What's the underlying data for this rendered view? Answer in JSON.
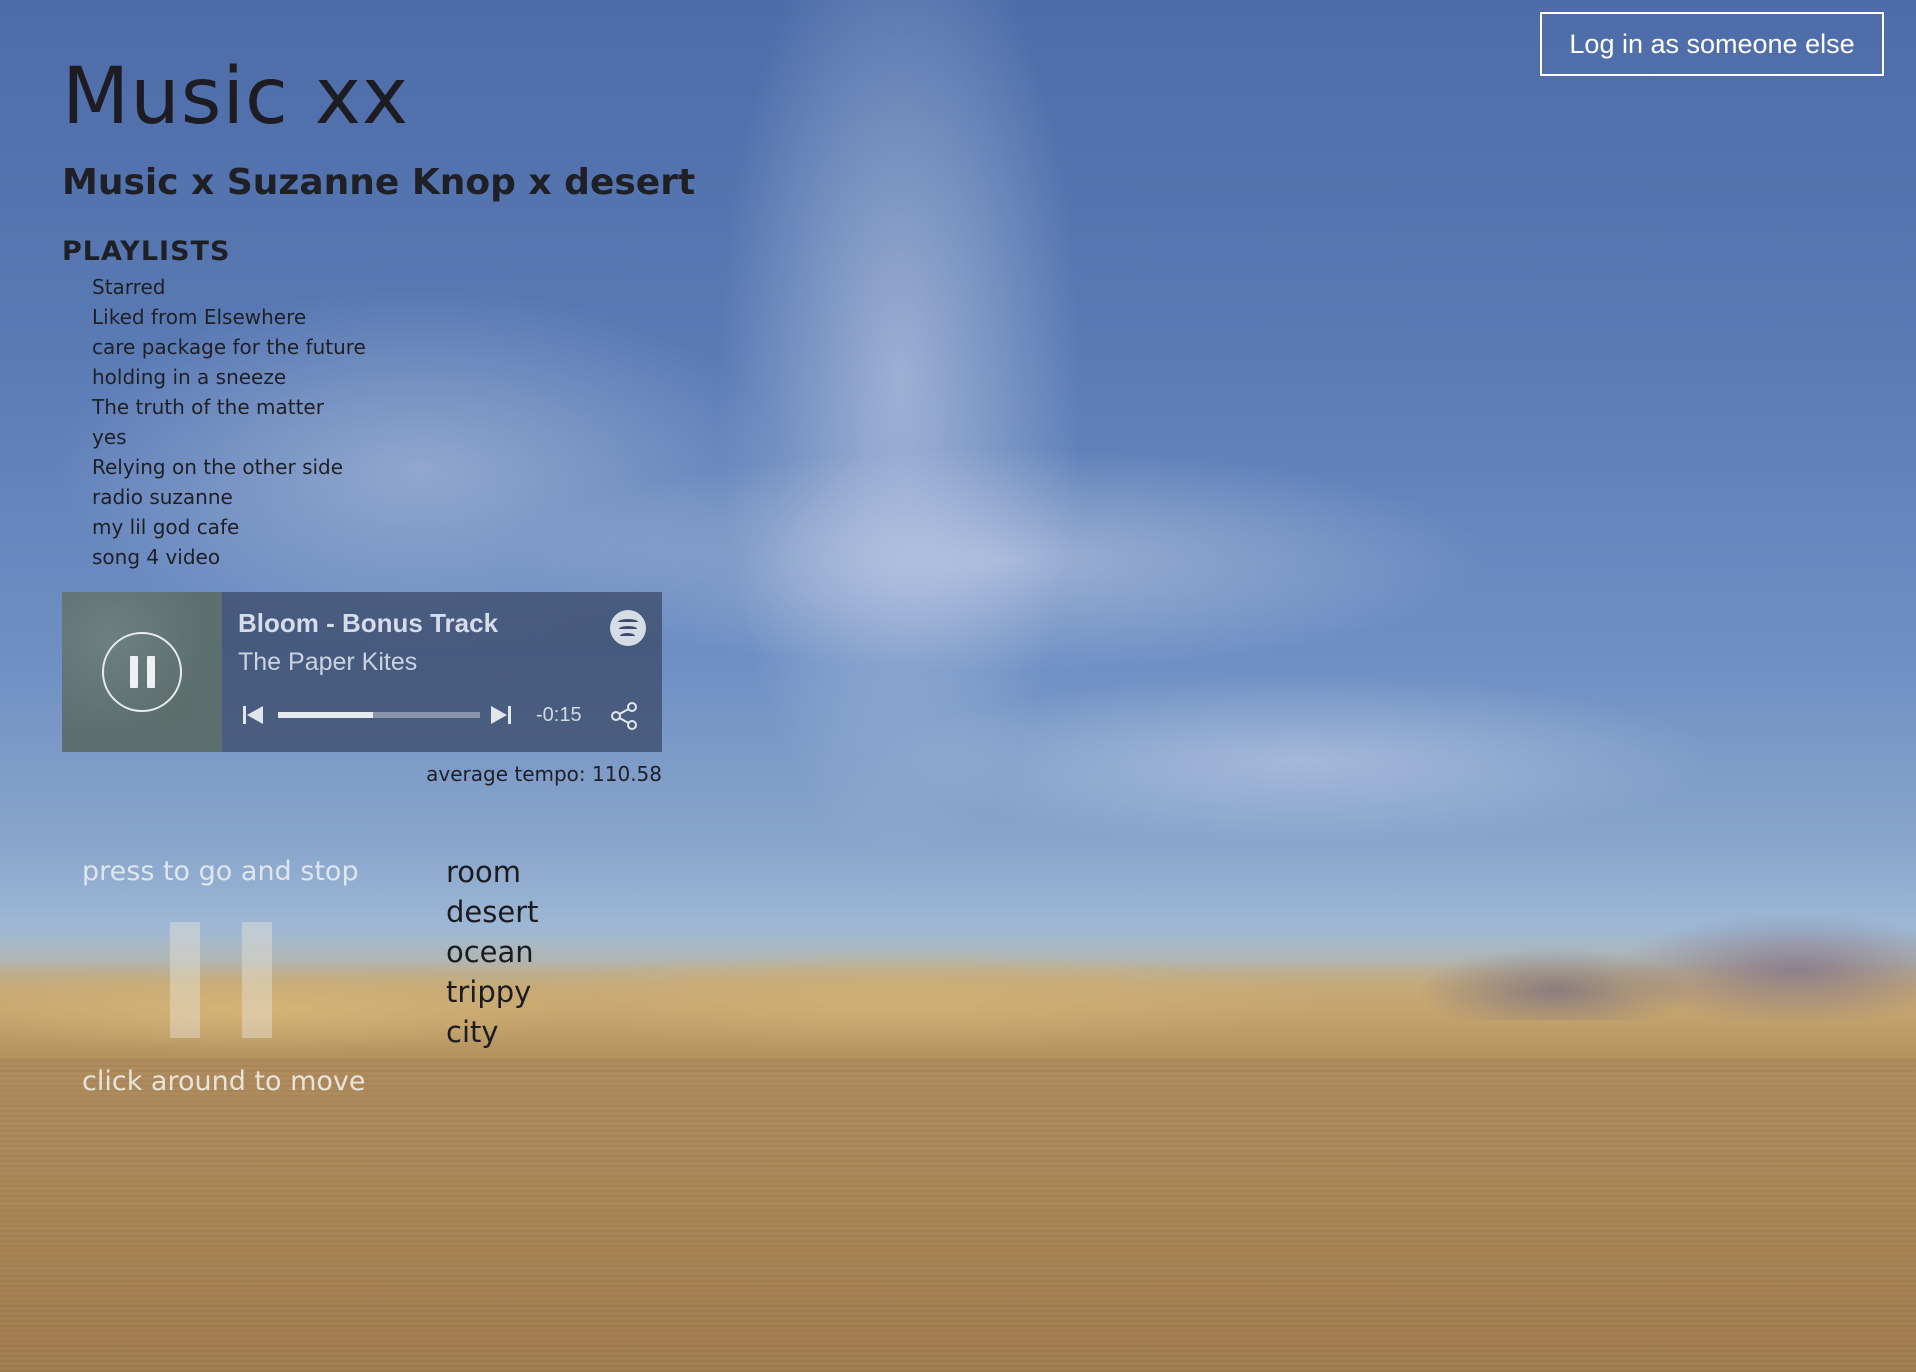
{
  "header": {
    "login_button": "Log in as someone else",
    "title": "Music xx",
    "subtitle": "Music x Suzanne Knop x desert"
  },
  "playlists": {
    "heading": "PLAYLISTS",
    "items": [
      "Starred",
      "Liked from Elsewhere",
      "care package for the future",
      "holding in a sneeze",
      "The truth of the matter",
      "yes",
      "Relying on the other side",
      "radio suzanne",
      "my lil god cafe",
      "song 4 video"
    ]
  },
  "player": {
    "track": "Bloom - Bonus Track",
    "artist": "The Paper Kites",
    "time_remaining": "-0:15",
    "progress_fraction": 0.47,
    "state_icon": "pause-icon",
    "service_icon": "spotify-icon",
    "share_icon": "share-icon"
  },
  "tempo_label": "average tempo: 110.58",
  "controls": {
    "press_hint": "press to go and stop",
    "move_hint": "click around to move"
  },
  "scenes": [
    "room",
    "desert",
    "ocean",
    "trippy",
    "city"
  ],
  "colors": {
    "sky": "#5a7ab4",
    "sand": "#ab8758",
    "player_bg": "#384664"
  }
}
